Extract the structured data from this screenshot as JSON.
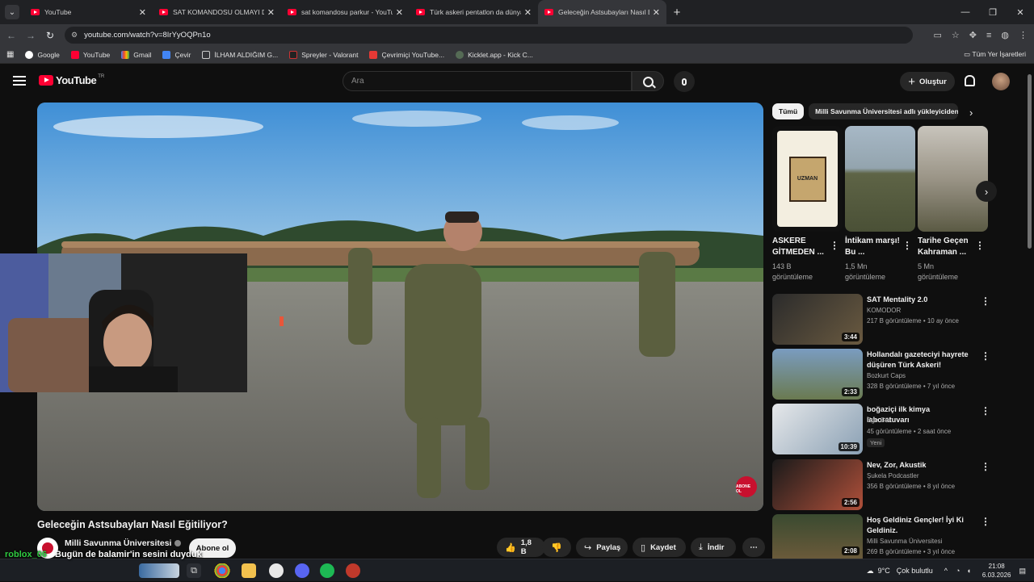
{
  "browser": {
    "tabs": [
      {
        "title": "YouTube",
        "active": false
      },
      {
        "title": "SAT KOMANDOSU OLMAYI DENE",
        "active": false
      },
      {
        "title": "sat komandosu parkur - YouTube",
        "active": false
      },
      {
        "title": "Türk askeri pentatlon da dünya",
        "active": false
      },
      {
        "title": "Geleceğin Astsubayları Nasıl Eğ",
        "active": true
      }
    ],
    "url": "youtube.com/watch?v=8IrYyOQPn1o",
    "bookmarks": [
      "Google",
      "YouTube",
      "Gmail",
      "Çevir",
      "İLHAM ALDIĞIM G...",
      "Spreyler - Valorant",
      "Çevrimiçi YouTube...",
      "Kicklet.app - Kick C..."
    ],
    "all_bookmarks": "Tüm Yer İşaretleri"
  },
  "youtube": {
    "logo": "YouTube",
    "logo_region": "TR",
    "search_placeholder": "Ara",
    "create_label": "Oluştur",
    "video_title": "Geleceğin Astsubayları Nasıl Eğitiliyor?",
    "channel_name": "Milli Savunma Üniversitesi",
    "subscribe_label": "Abone ol",
    "likes": "1,8 B",
    "share_label": "Paylaş",
    "save_label": "Kaydet",
    "download_label": "İndir",
    "player_badge": "ABONE OL"
  },
  "overlay": {
    "username": "roblox_06",
    "message": "Bugün de balamir'in sesini duyduk"
  },
  "sidebar": {
    "chips": [
      "Tümü",
      "Milli Savunma Üniversitesi adlı yükleyiciden"
    ],
    "shorts": [
      {
        "title": "ASKERE GİTMEDEN ...",
        "views": "143 B görüntüleme",
        "thumb_text": "UZMAN"
      },
      {
        "title": "İntikam marşı! Bu ...",
        "views": "1,5 Mn görüntüleme",
        "thumb_text": ""
      },
      {
        "title": "Tarihe Geçen Kahraman ...",
        "views": "5 Mn görüntüleme",
        "thumb_text": ""
      }
    ],
    "videos": [
      {
        "title": "SAT Mentality 2.0",
        "channel": "KOMODOR",
        "meta": "217 B görüntüleme • 10 ay önce",
        "duration": "3:44",
        "badge": ""
      },
      {
        "title": "Hollandalı gazeteciyi hayrete düşüren Türk Askeri!",
        "channel": "Bozkurt Caps",
        "meta": "328 B görüntüleme • 7 yıl önce",
        "duration": "2:33",
        "badge": ""
      },
      {
        "title": "boğaziçi ilk kimya laboratuvarı",
        "channel": "Ege Gül",
        "meta": "45 görüntüleme • 2 saat önce",
        "duration": "10:39",
        "badge": "Yeni"
      },
      {
        "title": "Nev, Zor, Akustik",
        "channel": "Şukela Podcastler",
        "meta": "356 B görüntüleme • 8 yıl önce",
        "duration": "2:56",
        "badge": ""
      },
      {
        "title": "Hoş Geldiniz Gençler! İyi Ki Geldiniz.",
        "channel": "Milli Savunma Üniversitesi",
        "meta": "269 B görüntüleme • 3 yıl önce",
        "duration": "2:08",
        "badge": ""
      }
    ]
  },
  "taskbar": {
    "weather_temp": "9°C",
    "weather_text": "Çok bulutlu",
    "time": "21:08",
    "date": "6.03.2026"
  },
  "colors": {
    "youtube_red": "#ff0033",
    "background": "#0f0f0f",
    "chat_name": "#2ecc40"
  }
}
